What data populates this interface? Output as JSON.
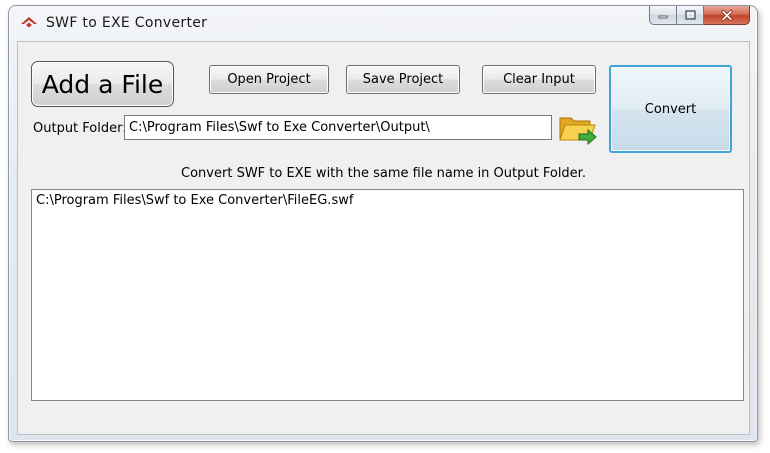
{
  "window": {
    "title": "SWF to EXE Converter",
    "icon": "red-house-logo-icon",
    "caption_buttons": [
      "minimize-icon",
      "maximize-icon",
      "close-icon"
    ]
  },
  "toolbar": {
    "add_file_label": "Add a File",
    "open_project_label": "Open Project",
    "save_project_label": "Save Project",
    "clear_input_label": "Clear Input",
    "convert_label": "Convert"
  },
  "output": {
    "label": "Output Folder:",
    "value": "C:\\Program Files\\Swf to Exe Converter\\Output\\",
    "browse_icon": "open-folder-arrow-icon"
  },
  "hint": "Convert SWF to EXE with the same file name in Output Folder.",
  "files": [
    "C:\\Program Files\\Swf to Exe Converter\\FileEG.swf"
  ],
  "colors": {
    "convert_border": "#3da5d9",
    "close_button": "#c1442a",
    "app_icon": "#c0392b"
  }
}
